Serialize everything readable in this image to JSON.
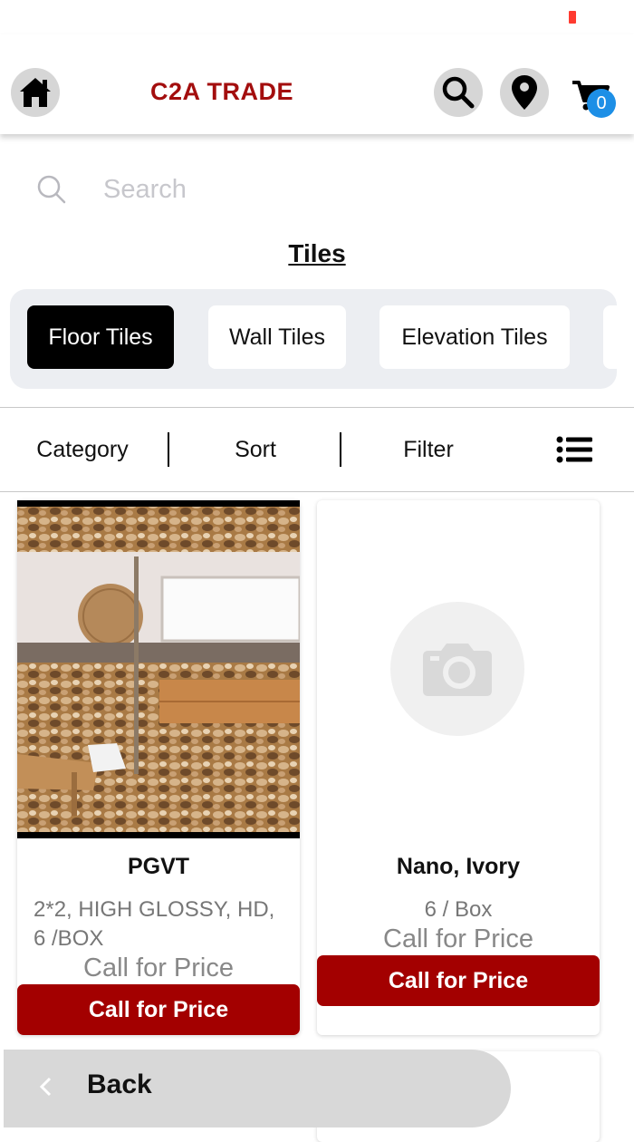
{
  "header": {
    "brand": "C2A TRADE",
    "cart_count": "0",
    "accent": "#a30e0e",
    "badge_color": "#1d8fe6",
    "icons": [
      "home-icon",
      "search-icon",
      "location-icon",
      "cart-icon"
    ]
  },
  "search": {
    "placeholder": "Search"
  },
  "section": {
    "title": "Tiles"
  },
  "categories": {
    "items": [
      "Floor Tiles",
      "Wall Tiles",
      "Elevation Tiles"
    ],
    "active": "Floor Tiles"
  },
  "toolbar": {
    "category": "Category",
    "sort": "Sort",
    "filter": "Filter"
  },
  "products": [
    {
      "name": "PGVT",
      "desc_line1": "2*2, HIGH GLOSSY, HD,",
      "desc_line2": "6 /BOX",
      "price_text": "Call for Price",
      "button": "Call for Price"
    },
    {
      "name": "Nano, Ivory",
      "desc_line1": "6 / Box",
      "price_text": "Call for Price",
      "button": "Call for Price"
    }
  ],
  "footer": {
    "back": "Back"
  }
}
